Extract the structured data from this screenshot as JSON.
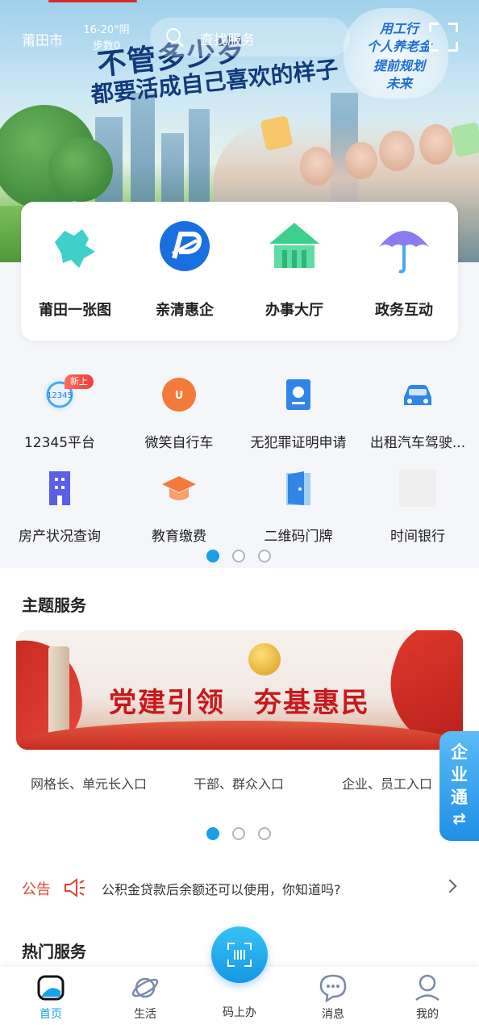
{
  "header": {
    "city": "莆田市",
    "weather_line1": "16-20°阴",
    "weather_line2": "步数0",
    "search_placeholder": "查找服务"
  },
  "banner": {
    "slogan_line1": "不管多少岁",
    "slogan_line2": "都要活成自己喜欢的样子",
    "cloud_lines": [
      "用工行",
      "个人养老金",
      "提前规划",
      "未来"
    ]
  },
  "top_services": [
    {
      "label": "莆田一张图",
      "icon": "map-icon"
    },
    {
      "label": "亲清惠企",
      "icon": "enterprise-logo-icon"
    },
    {
      "label": "办事大厅",
      "icon": "hall-building-icon"
    },
    {
      "label": "政务互动",
      "icon": "umbrella-icon"
    }
  ],
  "grid_services": [
    {
      "label": "12345平台",
      "icon": "hotline-12345-icon"
    },
    {
      "label": "微笑自行车",
      "icon": "smile-bike-icon"
    },
    {
      "label": "无犯罪证明申请",
      "icon": "certificate-icon"
    },
    {
      "label": "出租汽车驾驶...",
      "icon": "taxi-icon"
    },
    {
      "label": "房产状况查询",
      "icon": "building-icon"
    },
    {
      "label": "教育缴费",
      "icon": "graduation-cap-icon"
    },
    {
      "label": "二维码门牌",
      "icon": "door-icon"
    },
    {
      "label": "时间银行",
      "icon": "placeholder-icon"
    }
  ],
  "new_badge": "新上",
  "grid_pager": {
    "count": 3,
    "active": 0
  },
  "theme": {
    "title": "主题服务",
    "banner_text": "党建引领　夯基惠民",
    "entries": [
      "网格长、单元长入口",
      "干部、群众入口",
      "企业、员工入口"
    ],
    "pager": {
      "count": 3,
      "active": 0
    }
  },
  "side_tab": {
    "chars": [
      "企",
      "业",
      "通"
    ],
    "switch_glyph": "⇄"
  },
  "notice": {
    "label": "公告",
    "text": "公积金贷款后余额还可以使用，你知道吗?"
  },
  "hot": {
    "title": "热门服务"
  },
  "tabbar": [
    {
      "label": "首页",
      "icon": "home-icon",
      "active": true
    },
    {
      "label": "生活",
      "icon": "planet-icon",
      "active": false
    },
    {
      "label": "码上办",
      "icon": "scan-code-icon",
      "active": false
    },
    {
      "label": "消息",
      "icon": "message-icon",
      "active": false
    },
    {
      "label": "我的",
      "icon": "profile-icon",
      "active": false
    }
  ],
  "colors": {
    "accent": "#1aa0e6",
    "notice_red": "#e0452d",
    "party_red": "#c8181c"
  }
}
